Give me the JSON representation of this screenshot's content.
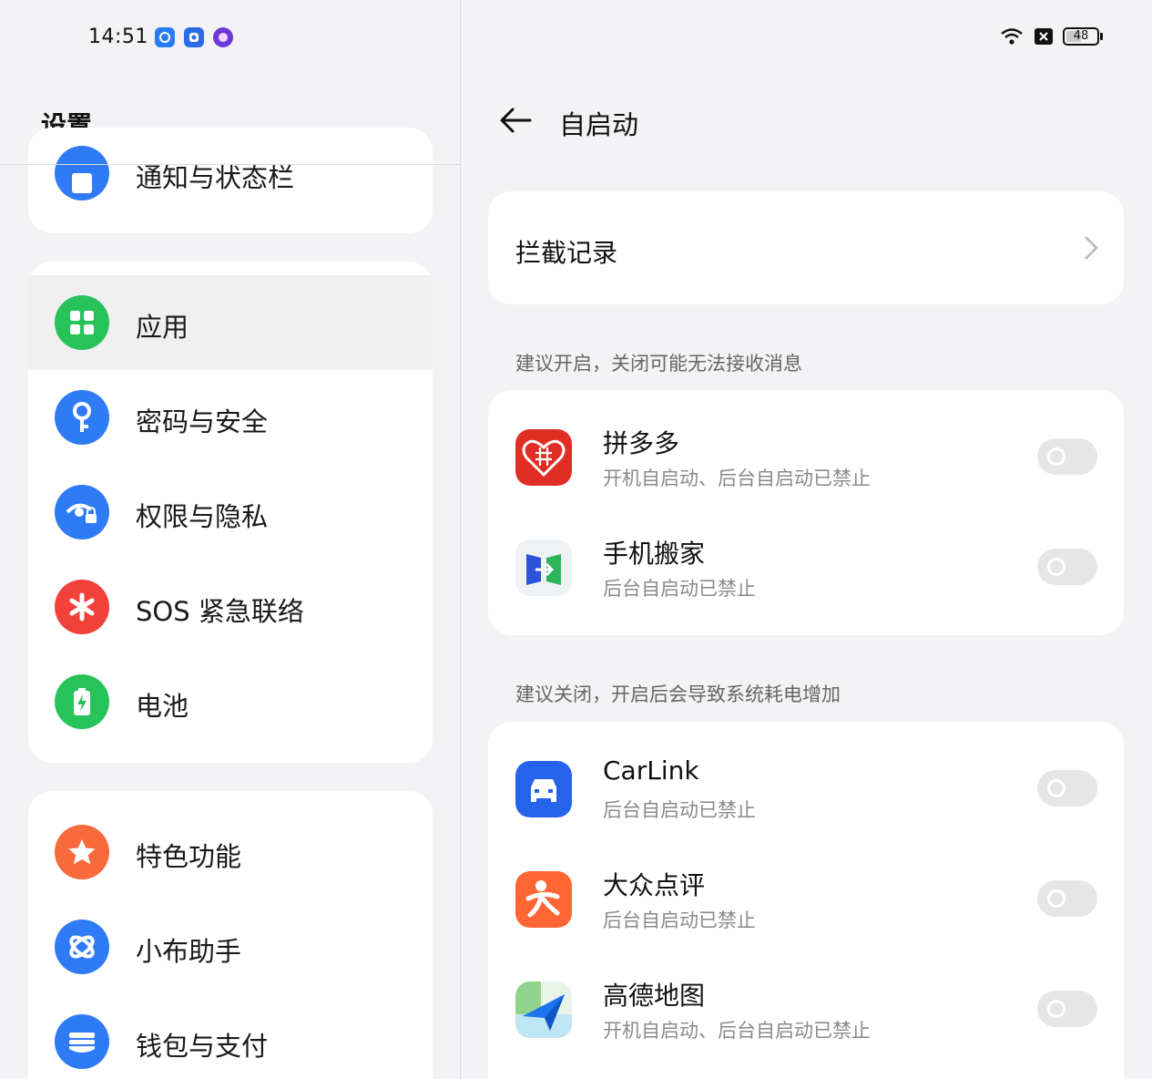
{
  "status_bar": {
    "time": "14:51",
    "battery": "48"
  },
  "left": {
    "title": "设置",
    "cut_item": "通知与状态栏",
    "group1": [
      {
        "label": "应用",
        "icon": "apps-grid-icon",
        "color": "#27c25a"
      },
      {
        "label": "密码与安全",
        "icon": "key-icon",
        "color": "#2f7bf5"
      },
      {
        "label": "权限与隐私",
        "icon": "privacy-eye-icon",
        "color": "#2f7bf5"
      },
      {
        "label": "SOS 紧急联络",
        "icon": "sos-asterisk-icon",
        "color": "#f0423a"
      },
      {
        "label": "电池",
        "icon": "battery-icon",
        "color": "#27c25a"
      }
    ],
    "group2": [
      {
        "label": "特色功能",
        "icon": "star-icon",
        "color": "#f86a3c"
      },
      {
        "label": "小布助手",
        "icon": "assistant-icon",
        "color": "#2f7bf5"
      },
      {
        "label": "钱包与支付",
        "icon": "wallet-icon",
        "color": "#2f7bf5"
      }
    ]
  },
  "right": {
    "title": "自启动",
    "intercept_label": "拦截记录",
    "section1_title": "建议开启，关闭可能无法接收消息",
    "section1_apps": [
      {
        "name": "拼多多",
        "status": "开机自启动、后台自启动已禁止",
        "icon": "pinduoduo-icon",
        "enabled": false
      },
      {
        "name": "手机搬家",
        "status": "后台自启动已禁止",
        "icon": "phone-clone-icon",
        "enabled": false
      }
    ],
    "section2_title": "建议关闭，开启后会导致系统耗电增加",
    "section2_apps": [
      {
        "name": "CarLink",
        "status": "后台自启动已禁止",
        "icon": "carlink-icon",
        "enabled": false
      },
      {
        "name": "大众点评",
        "status": "后台自启动已禁止",
        "icon": "dianping-icon",
        "enabled": false
      },
      {
        "name": "高德地图",
        "status": "开机自启动、后台自启动已禁止",
        "icon": "amap-icon",
        "enabled": false
      }
    ]
  }
}
